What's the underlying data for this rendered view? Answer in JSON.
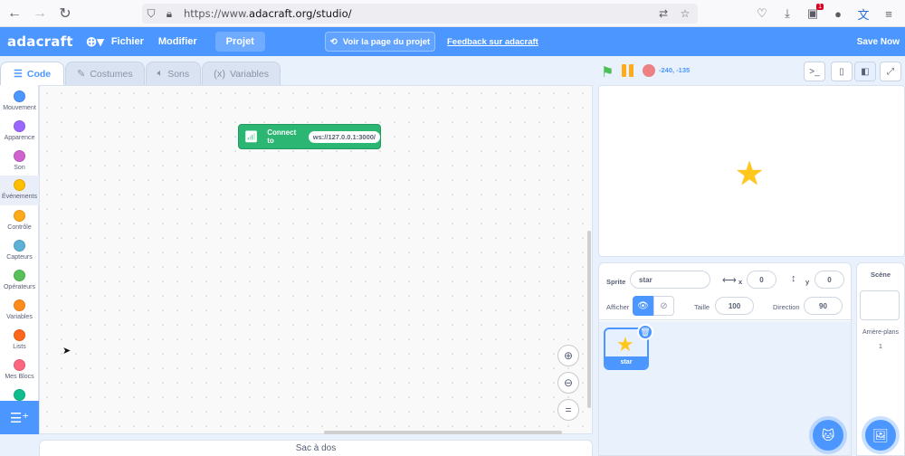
{
  "browser": {
    "url_scheme": "https://www.",
    "url_rest": "adacraft.org/studio/",
    "ext_badge": "1"
  },
  "menu": {
    "logo": "adacraft",
    "file": "Fichier",
    "edit": "Modifier",
    "project": "Projet",
    "view_project": "Voir la page du projet",
    "feedback": "Feedback sur adacraft",
    "save_now": "Save Now"
  },
  "tabs": [
    {
      "label": "Code",
      "active": true
    },
    {
      "label": "Costumes",
      "active": false
    },
    {
      "label": "Sons",
      "active": false
    },
    {
      "label": "Variables",
      "active": false
    }
  ],
  "stage_controls": {
    "coords": "-240, -135"
  },
  "categories": [
    {
      "label": "Mouvement",
      "color": "#4c97ff"
    },
    {
      "label": "Apparence",
      "color": "#9966ff"
    },
    {
      "label": "Son",
      "color": "#cf63cf"
    },
    {
      "label": "Événements",
      "color": "#ffbf00"
    },
    {
      "label": "Contrôle",
      "color": "#ffab19"
    },
    {
      "label": "Capteurs",
      "color": "#5cb1d6"
    },
    {
      "label": "Opérateurs",
      "color": "#59c059"
    },
    {
      "label": "Variables",
      "color": "#ff8c1a"
    },
    {
      "label": "Lists",
      "color": "#ff661a"
    },
    {
      "label": "Mes Blocs",
      "color": "#ff6680"
    },
    {
      "label": "",
      "color": "#0fbd8c"
    }
  ],
  "block": {
    "label": "Connect to",
    "value": "ws://127.0.0.1:3000/",
    "color": "#2bb673"
  },
  "backpack": "Sac à dos",
  "sprite_info": {
    "sprite_label": "Sprite",
    "sprite_name": "star",
    "x_label": "x",
    "x_value": "0",
    "y_label": "y",
    "y_value": "0",
    "show_label": "Afficher",
    "size_label": "Taille",
    "size_value": "100",
    "direction_label": "Direction",
    "direction_value": "90"
  },
  "sprites": [
    {
      "name": "star"
    }
  ],
  "stage_pane": {
    "title": "Scène",
    "backdrops_label": "Arrière-plans",
    "backdrops_count": "1"
  },
  "colors": {
    "accent": "#4c97ff",
    "extension_green": "#2bb673",
    "star": "#ffc61b"
  }
}
